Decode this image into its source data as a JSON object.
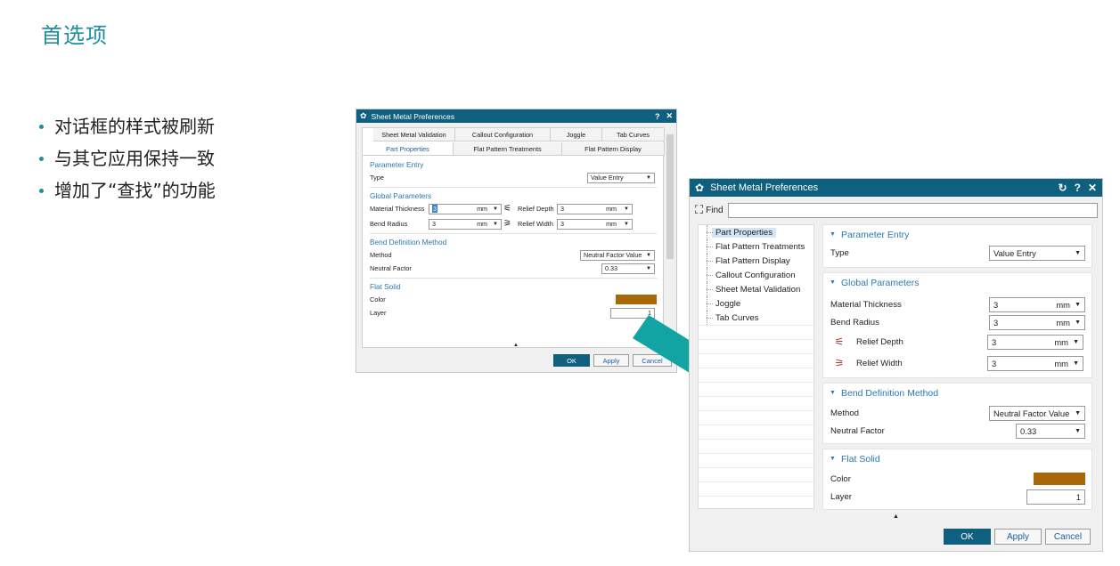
{
  "slide": {
    "title": "首选项",
    "bullets": [
      "对话框的样式被刷新",
      "与其它应用保持一致",
      "增加了“查找”的功能"
    ]
  },
  "old_dialog": {
    "title": "Sheet Metal Preferences",
    "help_glyph": "?",
    "close_glyph": "✕",
    "tabs_row1": [
      "Sheet Metal Validation",
      "Callout Configuration",
      "Joggle",
      "Tab Curves"
    ],
    "tabs_row2": [
      "Part Properties",
      "Flat Pattern Treatments",
      "Flat Pattern Display"
    ],
    "parameter_entry": {
      "heading": "Parameter Entry",
      "type_label": "Type",
      "type_value": "Value Entry"
    },
    "global_parameters": {
      "heading": "Global Parameters",
      "material_thickness_label": "Material Thickness",
      "material_thickness_value": "3",
      "material_thickness_unit": "mm",
      "bend_radius_label": "Bend Radius",
      "bend_radius_value": "3",
      "bend_radius_unit": "mm",
      "relief_depth_label": "Relief Depth",
      "relief_depth_value": "3",
      "relief_depth_unit": "mm",
      "relief_width_label": "Relief Width",
      "relief_width_value": "3",
      "relief_width_unit": "mm"
    },
    "bend_definition": {
      "heading": "Bend Definition Method",
      "method_label": "Method",
      "method_value": "Neutral Factor Value",
      "neutral_factor_label": "Neutral Factor",
      "neutral_factor_value": "0.33"
    },
    "flat_solid": {
      "heading": "Flat Solid",
      "color_label": "Color",
      "color": "#a86808",
      "layer_label": "Layer",
      "layer_value": "1"
    },
    "buttons": {
      "ok": "OK",
      "apply": "Apply",
      "cancel": "Cancel"
    }
  },
  "new_dialog": {
    "title": "Sheet Metal Preferences",
    "reset_glyph": "↻",
    "help_glyph": "?",
    "close_glyph": "✕",
    "find_label": "Find",
    "find_value": "",
    "tree": [
      "Part Properties",
      "Flat Pattern Treatments",
      "Flat Pattern Display",
      "Callout Configuration",
      "Sheet Metal Validation",
      "Joggle",
      "Tab Curves"
    ],
    "parameter_entry": {
      "heading": "Parameter Entry",
      "type_label": "Type",
      "type_value": "Value Entry"
    },
    "global_parameters": {
      "heading": "Global Parameters",
      "material_thickness_label": "Material Thickness",
      "material_thickness_value": "3",
      "material_thickness_unit": "mm",
      "bend_radius_label": "Bend Radius",
      "bend_radius_value": "3",
      "bend_radius_unit": "mm",
      "relief_depth_label": "Relief Depth",
      "relief_depth_value": "3",
      "relief_depth_unit": "mm",
      "relief_width_label": "Relief Width",
      "relief_width_value": "3",
      "relief_width_unit": "mm"
    },
    "bend_definition": {
      "heading": "Bend Definition Method",
      "method_label": "Method",
      "method_value": "Neutral Factor Value",
      "neutral_factor_label": "Neutral Factor",
      "neutral_factor_value": "0.33"
    },
    "flat_solid": {
      "heading": "Flat Solid",
      "color_label": "Color",
      "color": "#a86808",
      "layer_label": "Layer",
      "layer_value": "1"
    },
    "buttons": {
      "ok": "OK",
      "apply": "Apply",
      "cancel": "Cancel"
    }
  },
  "colors": {
    "title_bar": "#0f5f7f",
    "accent_teal": "#1f8fa0",
    "arrow": "#12a3a3",
    "section_blue": "#2a7ab0"
  }
}
